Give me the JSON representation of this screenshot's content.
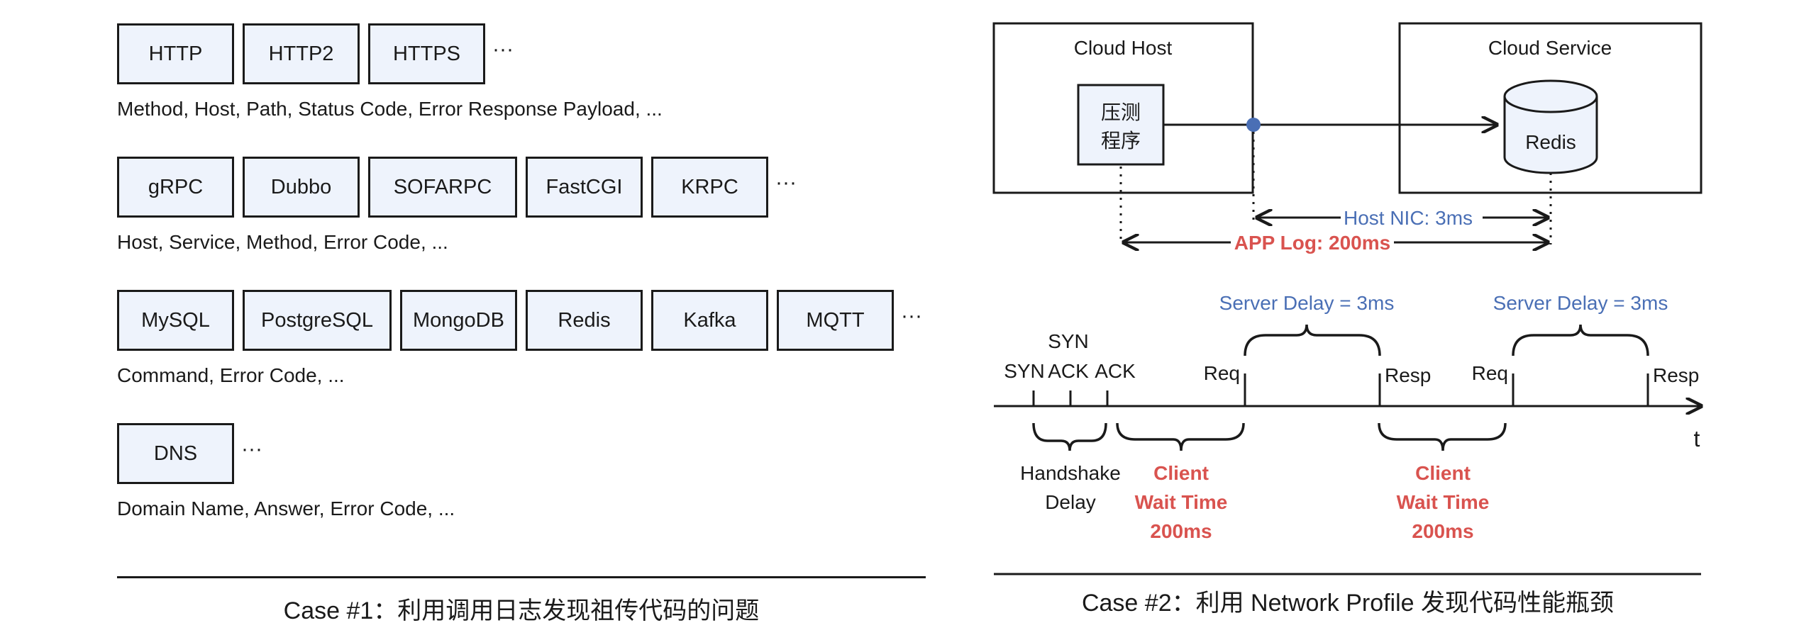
{
  "left": {
    "rows": [
      {
        "protocols": [
          "HTTP",
          "HTTP2",
          "HTTPS"
        ],
        "ellipsis": "···",
        "fields": "Method, Host, Path, Status Code, Error Response Payload, ..."
      },
      {
        "protocols": [
          "gRPC",
          "Dubbo",
          "SOFARPC",
          "FastCGI",
          "KRPC"
        ],
        "ellipsis": "···",
        "fields": "Host, Service, Method, Error Code, ..."
      },
      {
        "protocols": [
          "MySQL",
          "PostgreSQL",
          "MongoDB",
          "Redis",
          "Kafka",
          "MQTT"
        ],
        "ellipsis": "···",
        "fields": "Command, Error Code, ..."
      },
      {
        "protocols": [
          "DNS"
        ],
        "ellipsis": "···",
        "fields": "Domain Name, Answer, Error Code, ..."
      }
    ],
    "caption": "Case #1：利用调用日志发现祖传代码的问题"
  },
  "right": {
    "cloud_host_label": "Cloud Host",
    "cloud_service_label": "Cloud Service",
    "app_label_line1": "压测",
    "app_label_line2": "程序",
    "db_label": "Redis",
    "host_nic_label": "Host NIC: 3ms",
    "app_log_label": "APP Log: 200ms",
    "server_delay_1": "Server Delay = 3ms",
    "server_delay_2": "Server Delay = 3ms",
    "events": {
      "syn": "SYN",
      "synack_top": "SYN",
      "synack_bottom": "ACK",
      "ack": "ACK",
      "req1": "Req",
      "resp1": "Resp",
      "req2": "Req",
      "resp2": "Resp"
    },
    "axis_label": "t",
    "handshake_line1": "Handshake",
    "handshake_line2": "Delay",
    "client_wait_1": {
      "line1": "Client",
      "line2": "Wait Time",
      "line3": "200ms"
    },
    "client_wait_2": {
      "line1": "Client",
      "line2": "Wait Time",
      "line3": "200ms"
    },
    "caption": "Case #2：利用 Network Profile 发现代码性能瓶颈",
    "colors": {
      "blue": "#4a6fb5",
      "red": "#d9534f",
      "box_fill": "#eef3fc",
      "ink": "#1a1a1a"
    }
  }
}
